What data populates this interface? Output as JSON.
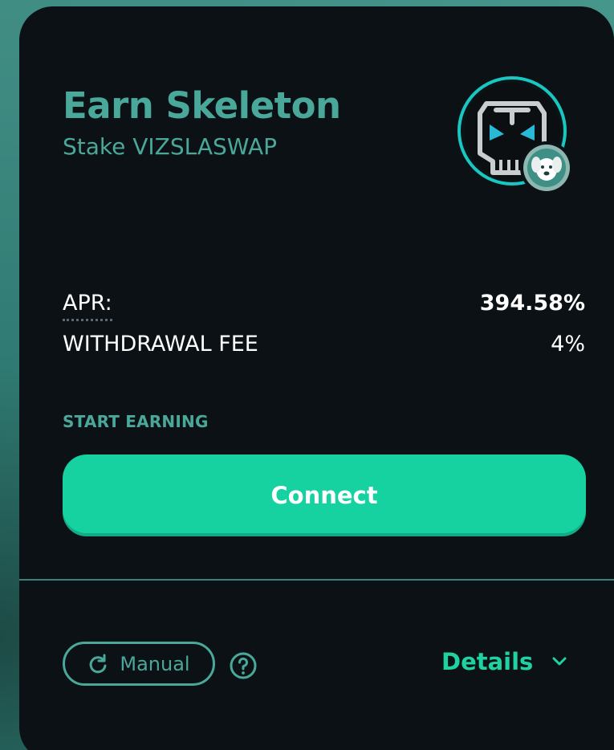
{
  "pool": {
    "title": "Earn Skeleton",
    "subtitle": "Stake VIZSLASWAP",
    "token_logo_icon": "skeleton-token-icon",
    "stake_token_badge_icon": "vizslaswap-dog-icon"
  },
  "stats": {
    "apr_label": "APR:",
    "apr_value": "394.58%",
    "fee_label": "WITHDRAWAL FEE",
    "fee_value": "4%"
  },
  "action": {
    "section_label": "START EARNING",
    "connect_label": "Connect"
  },
  "footer": {
    "manual_label": "Manual",
    "manual_icon": "refresh-icon",
    "help_icon": "question-circle-icon",
    "details_label": "Details",
    "details_icon": "chevron-down-icon"
  },
  "colors": {
    "accent": "#16d1a0",
    "title_teal": "#4aa89a",
    "card_bg": "#0b1115",
    "logo_ring": "#18c7c2"
  }
}
